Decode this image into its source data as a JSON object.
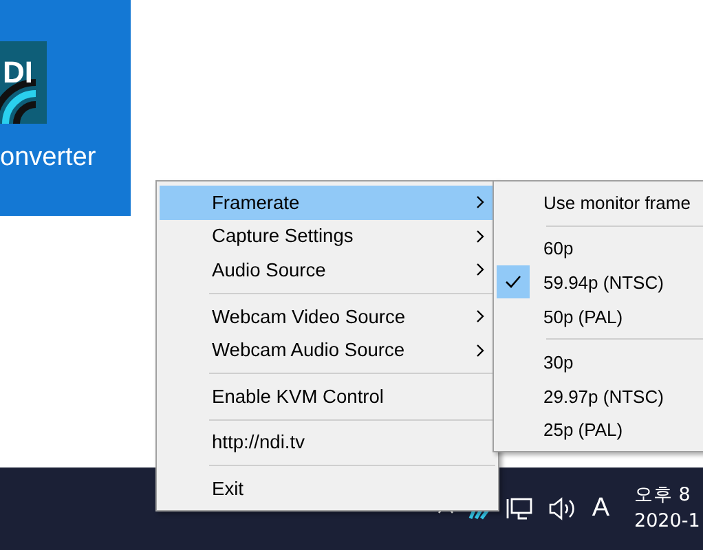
{
  "desktop_tile": {
    "logo_text": "DI",
    "label": "onverter"
  },
  "context_menu": {
    "items": [
      {
        "kind": "item",
        "label": "Framerate",
        "submenu": true,
        "selected": true
      },
      {
        "kind": "item",
        "label": "Capture Settings",
        "submenu": true,
        "selected": false
      },
      {
        "kind": "item",
        "label": "Audio Source",
        "submenu": true,
        "selected": false
      },
      {
        "kind": "separator"
      },
      {
        "kind": "item",
        "label": "Webcam Video Source",
        "submenu": true,
        "selected": false
      },
      {
        "kind": "item",
        "label": "Webcam Audio Source",
        "submenu": true,
        "selected": false
      },
      {
        "kind": "separator"
      },
      {
        "kind": "item",
        "label": "Enable KVM Control",
        "submenu": false,
        "selected": false
      },
      {
        "kind": "separator"
      },
      {
        "kind": "item",
        "label": "http://ndi.tv",
        "submenu": false,
        "selected": false
      },
      {
        "kind": "separator"
      },
      {
        "kind": "item",
        "label": "Exit",
        "submenu": false,
        "selected": false
      }
    ]
  },
  "framerate_submenu": {
    "items": [
      {
        "kind": "item",
        "label": "Use monitor frame",
        "checked": false
      },
      {
        "kind": "separator"
      },
      {
        "kind": "item",
        "label": "60p",
        "checked": false
      },
      {
        "kind": "item",
        "label": "59.94p (NTSC)",
        "checked": true
      },
      {
        "kind": "item",
        "label": "50p (PAL)",
        "checked": false
      },
      {
        "kind": "separator"
      },
      {
        "kind": "item",
        "label": "30p",
        "checked": false
      },
      {
        "kind": "item",
        "label": "29.97p (NTSC)",
        "checked": false
      },
      {
        "kind": "item",
        "label": "25p (PAL)",
        "checked": false
      }
    ]
  },
  "taskbar": {
    "input_indicator": "A",
    "time": "오후 8",
    "date": "2020-1"
  }
}
